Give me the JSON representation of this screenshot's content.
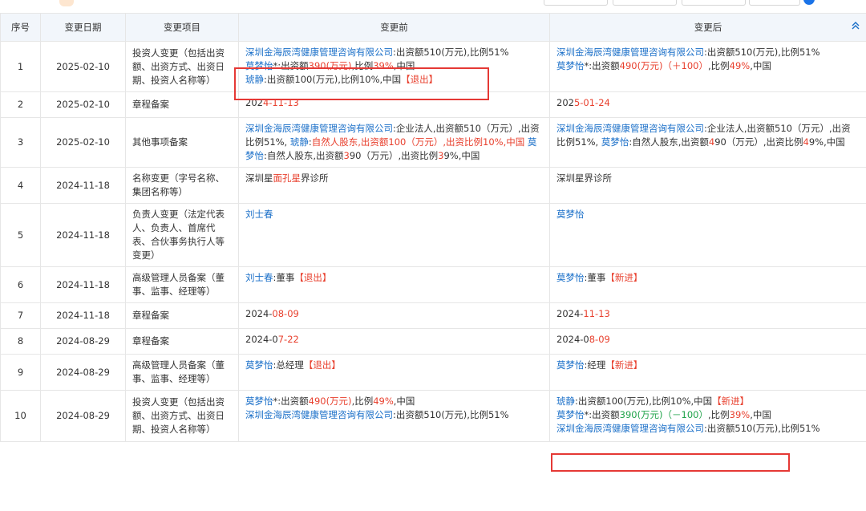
{
  "columns": [
    "序号",
    "变更日期",
    "变更项目",
    "变更前",
    "变更后"
  ],
  "collapse_icon": "chevron-up-icon",
  "rows": [
    {
      "no": "1",
      "date": "2025-02-10",
      "item": "投资人变更（包括出资额、出资方式、出资日期、投资人名称等）",
      "before": [
        [
          {
            "t": "深圳金海辰湾健康管理咨询有限公司",
            "c": "blue"
          },
          {
            "t": ":出资额510(万元),比例51%",
            "c": ""
          }
        ],
        [
          {
            "t": "莫梦怡",
            "c": "blue"
          },
          {
            "t": "*:出资额",
            "c": ""
          },
          {
            "t": "390(万元)",
            "c": "red"
          },
          {
            "t": ",比例",
            "c": ""
          },
          {
            "t": "39%",
            "c": "red"
          },
          {
            "t": ",中国",
            "c": ""
          }
        ],
        [
          {
            "t": "琥静",
            "c": "blue"
          },
          {
            "t": ":出资额100(万元),比例10%,中国",
            "c": ""
          },
          {
            "t": "【退出】",
            "c": "red"
          }
        ]
      ],
      "after": [
        [
          {
            "t": "深圳金海辰湾健康管理咨询有限公司",
            "c": "blue"
          },
          {
            "t": ":出资额510(万元),比例51%",
            "c": ""
          }
        ],
        [
          {
            "t": "莫梦怡",
            "c": "blue"
          },
          {
            "t": "*:出资额",
            "c": ""
          },
          {
            "t": "490(万元)（＋100）",
            "c": "red"
          },
          {
            "t": ",比例",
            "c": ""
          },
          {
            "t": "49%",
            "c": "red"
          },
          {
            "t": ",中国",
            "c": ""
          }
        ]
      ]
    },
    {
      "no": "2",
      "date": "2025-02-10",
      "item": "章程备案",
      "before": [
        [
          {
            "t": "202",
            "c": ""
          },
          {
            "t": "4-11-13",
            "c": "red"
          }
        ]
      ],
      "after": [
        [
          {
            "t": "202",
            "c": ""
          },
          {
            "t": "5-01-24",
            "c": "red"
          }
        ]
      ]
    },
    {
      "no": "3",
      "date": "2025-02-10",
      "item": "其他事项备案",
      "before": [
        [
          {
            "t": "深圳金海辰湾健康管理咨询有限公司",
            "c": "blue"
          },
          {
            "t": ":企业法人,出资额510（万元）,出资比例51%, ",
            "c": ""
          },
          {
            "t": "琥静",
            "c": "blue"
          },
          {
            "t": ":",
            "c": ""
          },
          {
            "t": "自然人股东,出资额100（万元）,出资比例10%,中国",
            "c": "red"
          },
          {
            "t": " ",
            "c": ""
          },
          {
            "t": "莫梦怡",
            "c": "blue"
          },
          {
            "t": ":自然人股东,出资额",
            "c": ""
          },
          {
            "t": "3",
            "c": "red"
          },
          {
            "t": "90（万元）,出资比例",
            "c": ""
          },
          {
            "t": "3",
            "c": "red"
          },
          {
            "t": "9%,中国",
            "c": ""
          }
        ]
      ],
      "after": [
        [
          {
            "t": "深圳金海辰湾健康管理咨询有限公司",
            "c": "blue"
          },
          {
            "t": ":企业法人,出资额510（万元）,出资比例51%, ",
            "c": ""
          },
          {
            "t": "莫梦怡",
            "c": "blue"
          },
          {
            "t": ":自然人股东,出资额",
            "c": ""
          },
          {
            "t": "4",
            "c": "red"
          },
          {
            "t": "90（万元）,出资比例",
            "c": ""
          },
          {
            "t": "4",
            "c": "red"
          },
          {
            "t": "9%,中国",
            "c": ""
          }
        ]
      ]
    },
    {
      "no": "4",
      "date": "2024-11-18",
      "item": "名称变更（字号名称、集团名称等）",
      "before": [
        [
          {
            "t": "深圳星",
            "c": ""
          },
          {
            "t": "面孔星",
            "c": "red"
          },
          {
            "t": "界诊所",
            "c": ""
          }
        ]
      ],
      "after": [
        [
          {
            "t": "深圳星界诊所",
            "c": ""
          }
        ]
      ]
    },
    {
      "no": "5",
      "date": "2024-11-18",
      "item": "负责人变更（法定代表人、负责人、首席代表、合伙事务执行人等变更）",
      "before": [
        [
          {
            "t": "刘士春",
            "c": "blue"
          }
        ]
      ],
      "after": [
        [
          {
            "t": "莫梦怡",
            "c": "blue"
          }
        ]
      ]
    },
    {
      "no": "6",
      "date": "2024-11-18",
      "item": "高级管理人员备案（董事、监事、经理等）",
      "before": [
        [
          {
            "t": "刘士春",
            "c": "blue"
          },
          {
            "t": ":董事",
            "c": ""
          },
          {
            "t": "【退出】",
            "c": "red"
          }
        ]
      ],
      "after": [
        [
          {
            "t": "莫梦怡",
            "c": "blue"
          },
          {
            "t": ":董事",
            "c": ""
          },
          {
            "t": "【新进】",
            "c": "red"
          }
        ]
      ]
    },
    {
      "no": "7",
      "date": "2024-11-18",
      "item": "章程备案",
      "before": [
        [
          {
            "t": "2024-",
            "c": ""
          },
          {
            "t": "08-09",
            "c": "red"
          }
        ]
      ],
      "after": [
        [
          {
            "t": "2024-",
            "c": ""
          },
          {
            "t": "11-13",
            "c": "red"
          }
        ]
      ]
    },
    {
      "no": "8",
      "date": "2024-08-29",
      "item": "章程备案",
      "before": [
        [
          {
            "t": "2024-0",
            "c": ""
          },
          {
            "t": "7-22",
            "c": "red"
          }
        ]
      ],
      "after": [
        [
          {
            "t": "2024-0",
            "c": ""
          },
          {
            "t": "8-09",
            "c": "red"
          }
        ]
      ]
    },
    {
      "no": "9",
      "date": "2024-08-29",
      "item": "高级管理人员备案（董事、监事、经理等）",
      "before": [
        [
          {
            "t": "莫梦怡",
            "c": "blue"
          },
          {
            "t": ":总经理",
            "c": ""
          },
          {
            "t": "【退出】",
            "c": "red"
          }
        ]
      ],
      "after": [
        [
          {
            "t": "莫梦怡",
            "c": "blue"
          },
          {
            "t": ":经理",
            "c": ""
          },
          {
            "t": "【新进】",
            "c": "red"
          }
        ]
      ]
    },
    {
      "no": "10",
      "date": "2024-08-29",
      "item": "投资人变更（包括出资额、出资方式、出资日期、投资人名称等）",
      "before": [
        [
          {
            "t": "莫梦怡",
            "c": "blue"
          },
          {
            "t": "*:出资额",
            "c": ""
          },
          {
            "t": "490(万元)",
            "c": "red"
          },
          {
            "t": ",比例",
            "c": ""
          },
          {
            "t": "49%",
            "c": "red"
          },
          {
            "t": ",中国",
            "c": ""
          }
        ],
        [
          {
            "t": "深圳金海辰湾健康管理咨询有限公司",
            "c": "blue"
          },
          {
            "t": ":出资额510(万元),比例51%",
            "c": ""
          }
        ]
      ],
      "after": [
        [
          {
            "t": "琥静",
            "c": "blue"
          },
          {
            "t": ":出资额100(万元),比例10%,中国",
            "c": ""
          },
          {
            "t": "【新进】",
            "c": "red"
          }
        ],
        [
          {
            "t": "莫梦怡",
            "c": "blue"
          },
          {
            "t": "*:出资额",
            "c": ""
          },
          {
            "t": "390(万元)（－100）",
            "c": "green"
          },
          {
            "t": ",比例",
            "c": ""
          },
          {
            "t": "39%",
            "c": "red"
          },
          {
            "t": ",中国",
            "c": ""
          }
        ],
        [
          {
            "t": "深圳金海辰湾健康管理咨询有限公司",
            "c": "blue"
          },
          {
            "t": ":出资额510(万元),比例51%",
            "c": ""
          }
        ]
      ]
    }
  ]
}
